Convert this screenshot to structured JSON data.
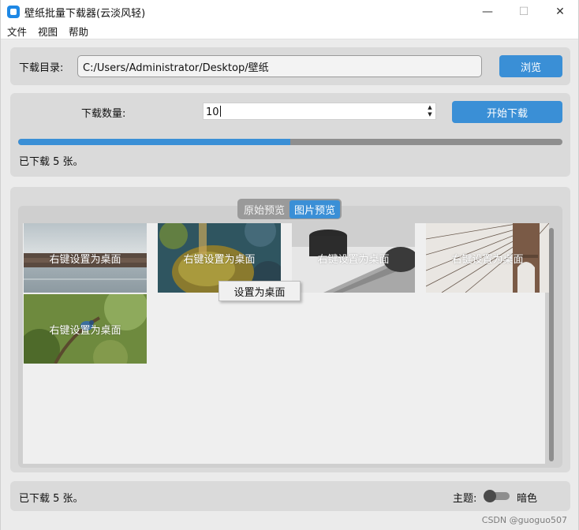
{
  "window": {
    "title": "壁纸批量下载器(云淡风轻)",
    "controls": {
      "minimize": "—",
      "maximize": "☐",
      "close": "✕"
    }
  },
  "menu": [
    "文件",
    "视图",
    "帮助"
  ],
  "directory": {
    "label": "下载目录:",
    "value": "C:/Users/Administrator/Desktop/壁纸",
    "browse_label": "浏览"
  },
  "download": {
    "count_label": "下载数量:",
    "count_value": "10",
    "start_label": "开始下载",
    "progress_fraction": 0.5,
    "status": "已下载 5 张。"
  },
  "preview": {
    "tabs": [
      {
        "label": "原始预览",
        "active": false
      },
      {
        "label": "图片预览",
        "active": true
      }
    ],
    "thumbnails": [
      {
        "label": "右键设置为桌面",
        "theme": "pier"
      },
      {
        "label": "右键设置为桌面",
        "theme": "moss"
      },
      {
        "label": "右键设置为桌面",
        "theme": "desk"
      },
      {
        "label": "右键设置为桌面",
        "theme": "bridge"
      },
      {
        "label": "右键设置为桌面",
        "theme": "bird"
      }
    ],
    "context_menu_item": "设置为桌面"
  },
  "statusbar": {
    "status": "已下载 5 张。",
    "theme_label": "主题:",
    "theme_value": "暗色"
  },
  "watermark": "CSDN @guoguo507",
  "colors": {
    "accent": "#3a8fd6",
    "panel": "#dadada",
    "background": "#ebebeb"
  }
}
